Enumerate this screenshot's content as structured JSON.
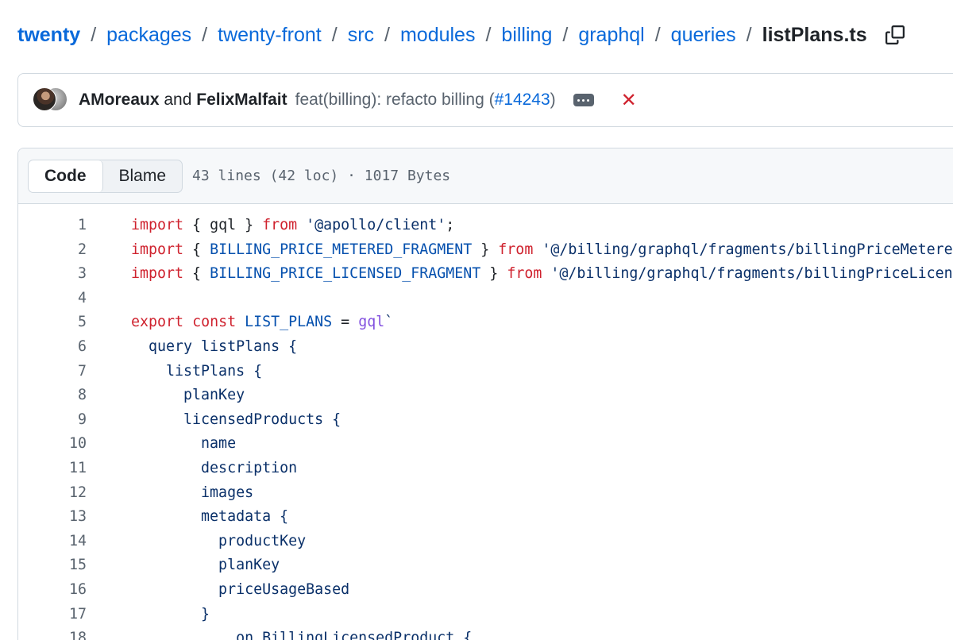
{
  "breadcrumb": {
    "segments": [
      "twenty",
      "packages",
      "twenty-front",
      "src",
      "modules",
      "billing",
      "graphql",
      "queries"
    ],
    "separator": "/",
    "current_file": "listPlans.ts"
  },
  "commit": {
    "author1": "AMoreaux",
    "conjunction": "and",
    "author2": "FelixMalfait",
    "message": "feat(billing): refacto billing (",
    "pr_number": "#14243",
    "message_end": ")",
    "status": "✕"
  },
  "file_header": {
    "tab_code": "Code",
    "tab_blame": "Blame",
    "meta": "43 lines (42 loc) · 1017 Bytes"
  },
  "colors": {
    "link": "#0969da",
    "keyword": "#cf222e",
    "string": "#0a3069",
    "constant": "#0550ae",
    "function": "#8250df",
    "status_fail": "#cf222e"
  },
  "code": {
    "lines": [
      {
        "n": "1",
        "tokens": [
          [
            "kw",
            "import"
          ],
          [
            "p",
            " { gql } "
          ],
          [
            "kw",
            "from"
          ],
          [
            "str",
            " '@apollo/client'"
          ],
          [
            "p",
            ";"
          ]
        ]
      },
      {
        "n": "2",
        "tokens": [
          [
            "kw",
            "import"
          ],
          [
            "p",
            " { "
          ],
          [
            "const",
            "BILLING_PRICE_METERED_FRAGMENT"
          ],
          [
            "p",
            " } "
          ],
          [
            "kw",
            "from"
          ],
          [
            "str",
            " '@/billing/graphql/fragments/billingPriceMetere"
          ]
        ]
      },
      {
        "n": "3",
        "tokens": [
          [
            "kw",
            "import"
          ],
          [
            "p",
            " { "
          ],
          [
            "const",
            "BILLING_PRICE_LICENSED_FRAGMENT"
          ],
          [
            "p",
            " } "
          ],
          [
            "kw",
            "from"
          ],
          [
            "str",
            " '@/billing/graphql/fragments/billingPriceLicen"
          ]
        ]
      },
      {
        "n": "4",
        "tokens": []
      },
      {
        "n": "5",
        "tokens": [
          [
            "kw",
            "export"
          ],
          [
            "p",
            " "
          ],
          [
            "kw",
            "const"
          ],
          [
            "p",
            " "
          ],
          [
            "const",
            "LIST_PLANS"
          ],
          [
            "p",
            " = "
          ],
          [
            "fn",
            "gql"
          ],
          [
            "gql",
            "`"
          ]
        ]
      },
      {
        "n": "6",
        "tokens": [
          [
            "gql",
            "  query listPlans {"
          ]
        ]
      },
      {
        "n": "7",
        "tokens": [
          [
            "gql",
            "    listPlans {"
          ]
        ]
      },
      {
        "n": "8",
        "tokens": [
          [
            "gql",
            "      planKey"
          ]
        ]
      },
      {
        "n": "9",
        "tokens": [
          [
            "gql",
            "      licensedProducts {"
          ]
        ]
      },
      {
        "n": "10",
        "tokens": [
          [
            "gql",
            "        name"
          ]
        ]
      },
      {
        "n": "11",
        "tokens": [
          [
            "gql",
            "        description"
          ]
        ]
      },
      {
        "n": "12",
        "tokens": [
          [
            "gql",
            "        images"
          ]
        ]
      },
      {
        "n": "13",
        "tokens": [
          [
            "gql",
            "        metadata {"
          ]
        ]
      },
      {
        "n": "14",
        "tokens": [
          [
            "gql",
            "          productKey"
          ]
        ]
      },
      {
        "n": "15",
        "tokens": [
          [
            "gql",
            "          planKey"
          ]
        ]
      },
      {
        "n": "16",
        "tokens": [
          [
            "gql",
            "          priceUsageBased"
          ]
        ]
      },
      {
        "n": "17",
        "tokens": [
          [
            "gql",
            "        }"
          ]
        ]
      },
      {
        "n": "18",
        "tokens": [
          [
            "gql",
            "        ... on BillingLicensedProduct {"
          ]
        ]
      }
    ]
  }
}
